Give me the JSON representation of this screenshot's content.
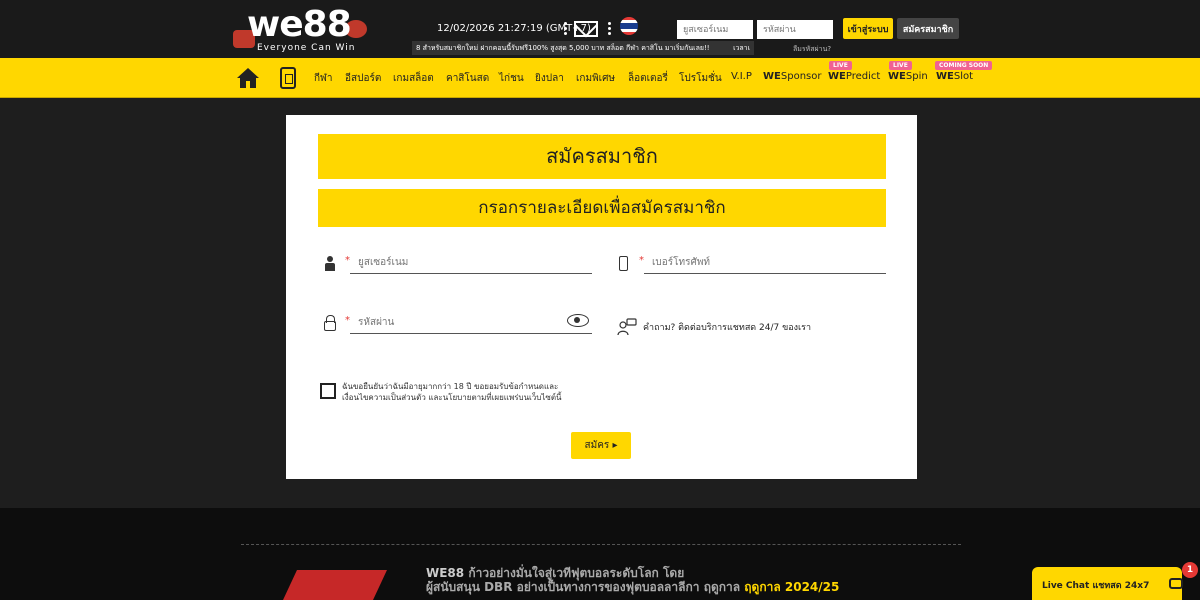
{
  "header": {
    "logo_text": "we88",
    "logo_tagline": "Everyone Can Win",
    "datetime": "12/02/2026 21:27:19  (GMT+7)",
    "marquee": "8 สำหรับสมาชิกใหม่ ฝากคอนนี้รับฟรี100% สูงสุด 5,000 บาท สล็อต กีฬา คาสิโน มาเริ่มกันเลย!!",
    "marquee_right": "เวลาเ",
    "username_placeholder": "ยูสเซอร์เนม",
    "password_placeholder": "รหัสผ่าน",
    "login_label": "เข้าสู่ระบบ",
    "signup_label": "สมัครสมาชิก",
    "forgot_label": "ลืมรหัสผ่าน?"
  },
  "nav": {
    "items": [
      {
        "label": "กีฬา"
      },
      {
        "label": "อีสปอร์ต"
      },
      {
        "label": "เกมสล็อต"
      },
      {
        "label": "คาสิโนสด"
      },
      {
        "label": "ไก่ชน"
      },
      {
        "label": "ยิงปลา"
      },
      {
        "label": "เกมพิเศษ"
      },
      {
        "label": "ล็อตเตอรี่"
      },
      {
        "label": "โปรโมชั่น"
      },
      {
        "label": "V.I.P"
      }
    ],
    "we_items": [
      {
        "prefix": "WE",
        "label": "Sponsor",
        "badge": ""
      },
      {
        "prefix": "WE",
        "label": "Predict",
        "badge": "LIVE"
      },
      {
        "prefix": "WE",
        "label": "Spin",
        "badge": "LIVE"
      },
      {
        "prefix": "WE",
        "label": "Slot",
        "badge": "COMING SOON"
      }
    ]
  },
  "form": {
    "title": "สมัครสมาชิก",
    "subtitle": "กรอกรายละเอียดเพื่อสมัครสมาชิก",
    "required_mark": "*",
    "username_placeholder": "ยูสเซอร์เนม",
    "phone_placeholder": "เบอร์โทรศัพท์",
    "password_placeholder": "รหัสผ่าน",
    "support_text": "คำถาม? ติดต่อบริการแชทสด 24/7 ของเรา",
    "terms_line1": "ฉันขอยืนยันว่าฉันมีอายุมากกว่า 18 ปี ขอยอมรับข้อกำหนดและ",
    "terms_line2": "เงื่อนไขความเป็นส่วนตัว และนโยบายตามที่เผยแพร่บนเว็บไซต์นี้",
    "submit_label": "สมัคร ▸"
  },
  "footer": {
    "brand": "WE88",
    "line1": " ก้าวอย่างมั่นใจสู่เวทีฟุตบอลระดับโลก โดย",
    "line2": "ผู้สนับสนุน DBR อย่างเป็นทางการของฟุตบอลลาลีกา ฤดูกาล ",
    "line2_highlight": "ฤดูกาล 2024/25"
  },
  "livechat": {
    "label": "Live Chat แชทสด 24x7",
    "notification_count": "1"
  },
  "colors": {
    "accent": "#ffd700",
    "header_bg": "#1a1a1a",
    "page_bg": "#1e1e1e",
    "badge": "#f06292"
  }
}
